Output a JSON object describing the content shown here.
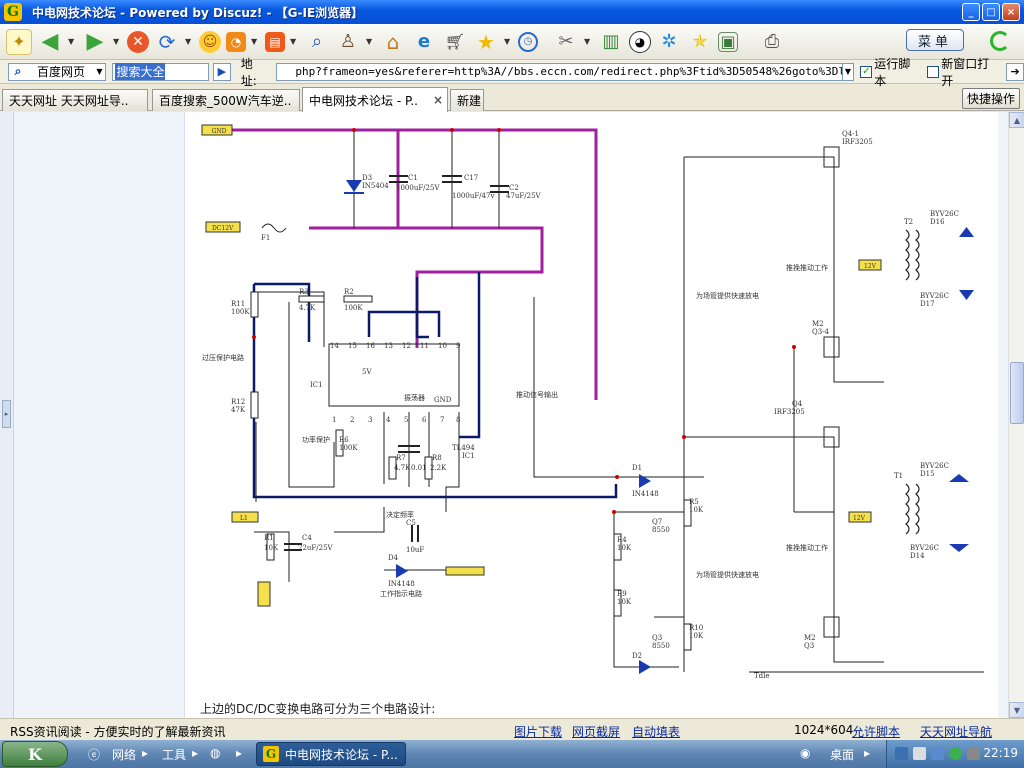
{
  "window": {
    "app_icon_letter": "G",
    "title": "中电网技术论坛 - Powered by Discuz! - 【G-IE浏览器】",
    "minimize": "_",
    "maximize": "□",
    "close": "×"
  },
  "toolbar": {
    "menu_label": "菜单"
  },
  "addressbar": {
    "search_engine": "百度网页",
    "search_value": "搜索大全",
    "address_label": "地址:",
    "url": "php?frameon=yes&referer=http%3A//bbs.eccn.com/redirect.php%3Ftid%3D50548%26goto%3Dlastpost",
    "run_script_label": "运行脚本",
    "run_script_checked": true,
    "new_window_label": "新窗口打开",
    "new_window_checked": false
  },
  "tabs": [
    {
      "label": "天天网址 天天网址导..",
      "active": false
    },
    {
      "label": "百度搜索_500W汽车逆..",
      "active": false
    },
    {
      "label": "中电网技术论坛 - P..",
      "active": true
    },
    {
      "label": "新建",
      "active": false
    }
  ],
  "quick_action": "快捷操作",
  "schematic": {
    "labels": {
      "gnd": "GND",
      "dc12v": "DC12V",
      "f1": "F1",
      "d3": "D3",
      "d3_part": "IN5404",
      "c1": "C1",
      "c1_val": "1000uF/25V",
      "c17": "C17",
      "c17_val": "1000uF/47v",
      "c2": "C2",
      "c2_val": "47uF/25V",
      "r11": "R11",
      "r11_val": "100K",
      "r3": "R3",
      "r3_val": "4.7K",
      "r2": "R2",
      "r2_val": "100K",
      "overvolt": "过压保护电路",
      "r12": "R12",
      "r12_val": "47K",
      "ic1": "IC1",
      "tl494": "TL494",
      "ic1b": "IC1",
      "pwm_out": "推动信号输出",
      "power_protect": "功率保护",
      "r6": "R6",
      "r6_val": "100K",
      "r7": "R7",
      "r7_val": "4.7K",
      "c3_val": "0.01",
      "r8": "R8",
      "r8_val": "2.2K",
      "freq": "决定频率",
      "c5": "C5",
      "c5_val": "10uF",
      "l1": "L1",
      "r1": "R1",
      "r1_val": "10K",
      "c4": "C4",
      "c4_val": "22uF/25V",
      "d4": "D4",
      "d4_part": "IN4148",
      "indicator": "工作指示电路",
      "d1": "D1",
      "d1_part": "IN4148",
      "r5": "R5",
      "r5_val": "10K",
      "q7": "Q7",
      "q7_part": "8550",
      "r4": "R4",
      "r4_val": "10K",
      "r9": "R9",
      "r9_val": "10K",
      "q3b": "Q3",
      "q3b_part": "8550",
      "r10": "R10",
      "r10_val": "10K",
      "d2": "D2",
      "fet_fast1": "为场管提供快速放电",
      "fet_fast2": "为场管提供快速放电",
      "q4top": "Q4-1",
      "q4top_part": "IRF3205",
      "push_pull1": "推挽推动工作",
      "l12v_a": "12V",
      "t2": "T2",
      "byv26c_a": "BYV26C",
      "d16": "D16",
      "byv26c_b": "BYV26C",
      "d17": "D17",
      "m2a": "M2",
      "q34": "Q3-4",
      "q4": "Q4",
      "q4_part": "IRF3205",
      "t1": "T1",
      "byv26c_c": "BYV26C",
      "d15": "D15",
      "push_pull2": "推挽推动工作",
      "l12v_b": "12V",
      "byv26c_d": "BYV26C",
      "d14": "D14",
      "m2b": "M2",
      "q3": "Q3",
      "tdle": "Tdle",
      "gnd_pin": "GND",
      "pins_top": [
        "14",
        "15",
        "16",
        "13",
        "12",
        "11",
        "10",
        "9"
      ],
      "pins_bot": [
        "1",
        "2",
        "3",
        "4",
        "5",
        "6",
        "7",
        "8"
      ],
      "ic_5v": "5V",
      "ic_osc": "振荡器"
    }
  },
  "caption": "上边的DC/DC变换电路可分为三个电路设计:",
  "statusbar": {
    "rss": "RSS资讯阅读 - 方便实时的了解最新资讯",
    "img_download": "图片下载",
    "screenshot": "网页截屏",
    "autofill": "自动填表",
    "resolution": "1024*604",
    "allow_script": "允许脚本",
    "site_nav": "天天网址导航"
  },
  "taskbar": {
    "start_letter": "K",
    "network": "网络",
    "tools": "工具",
    "task_label": "中电网技术论坛 - P...",
    "desktop": "桌面",
    "clock": "22:19"
  }
}
